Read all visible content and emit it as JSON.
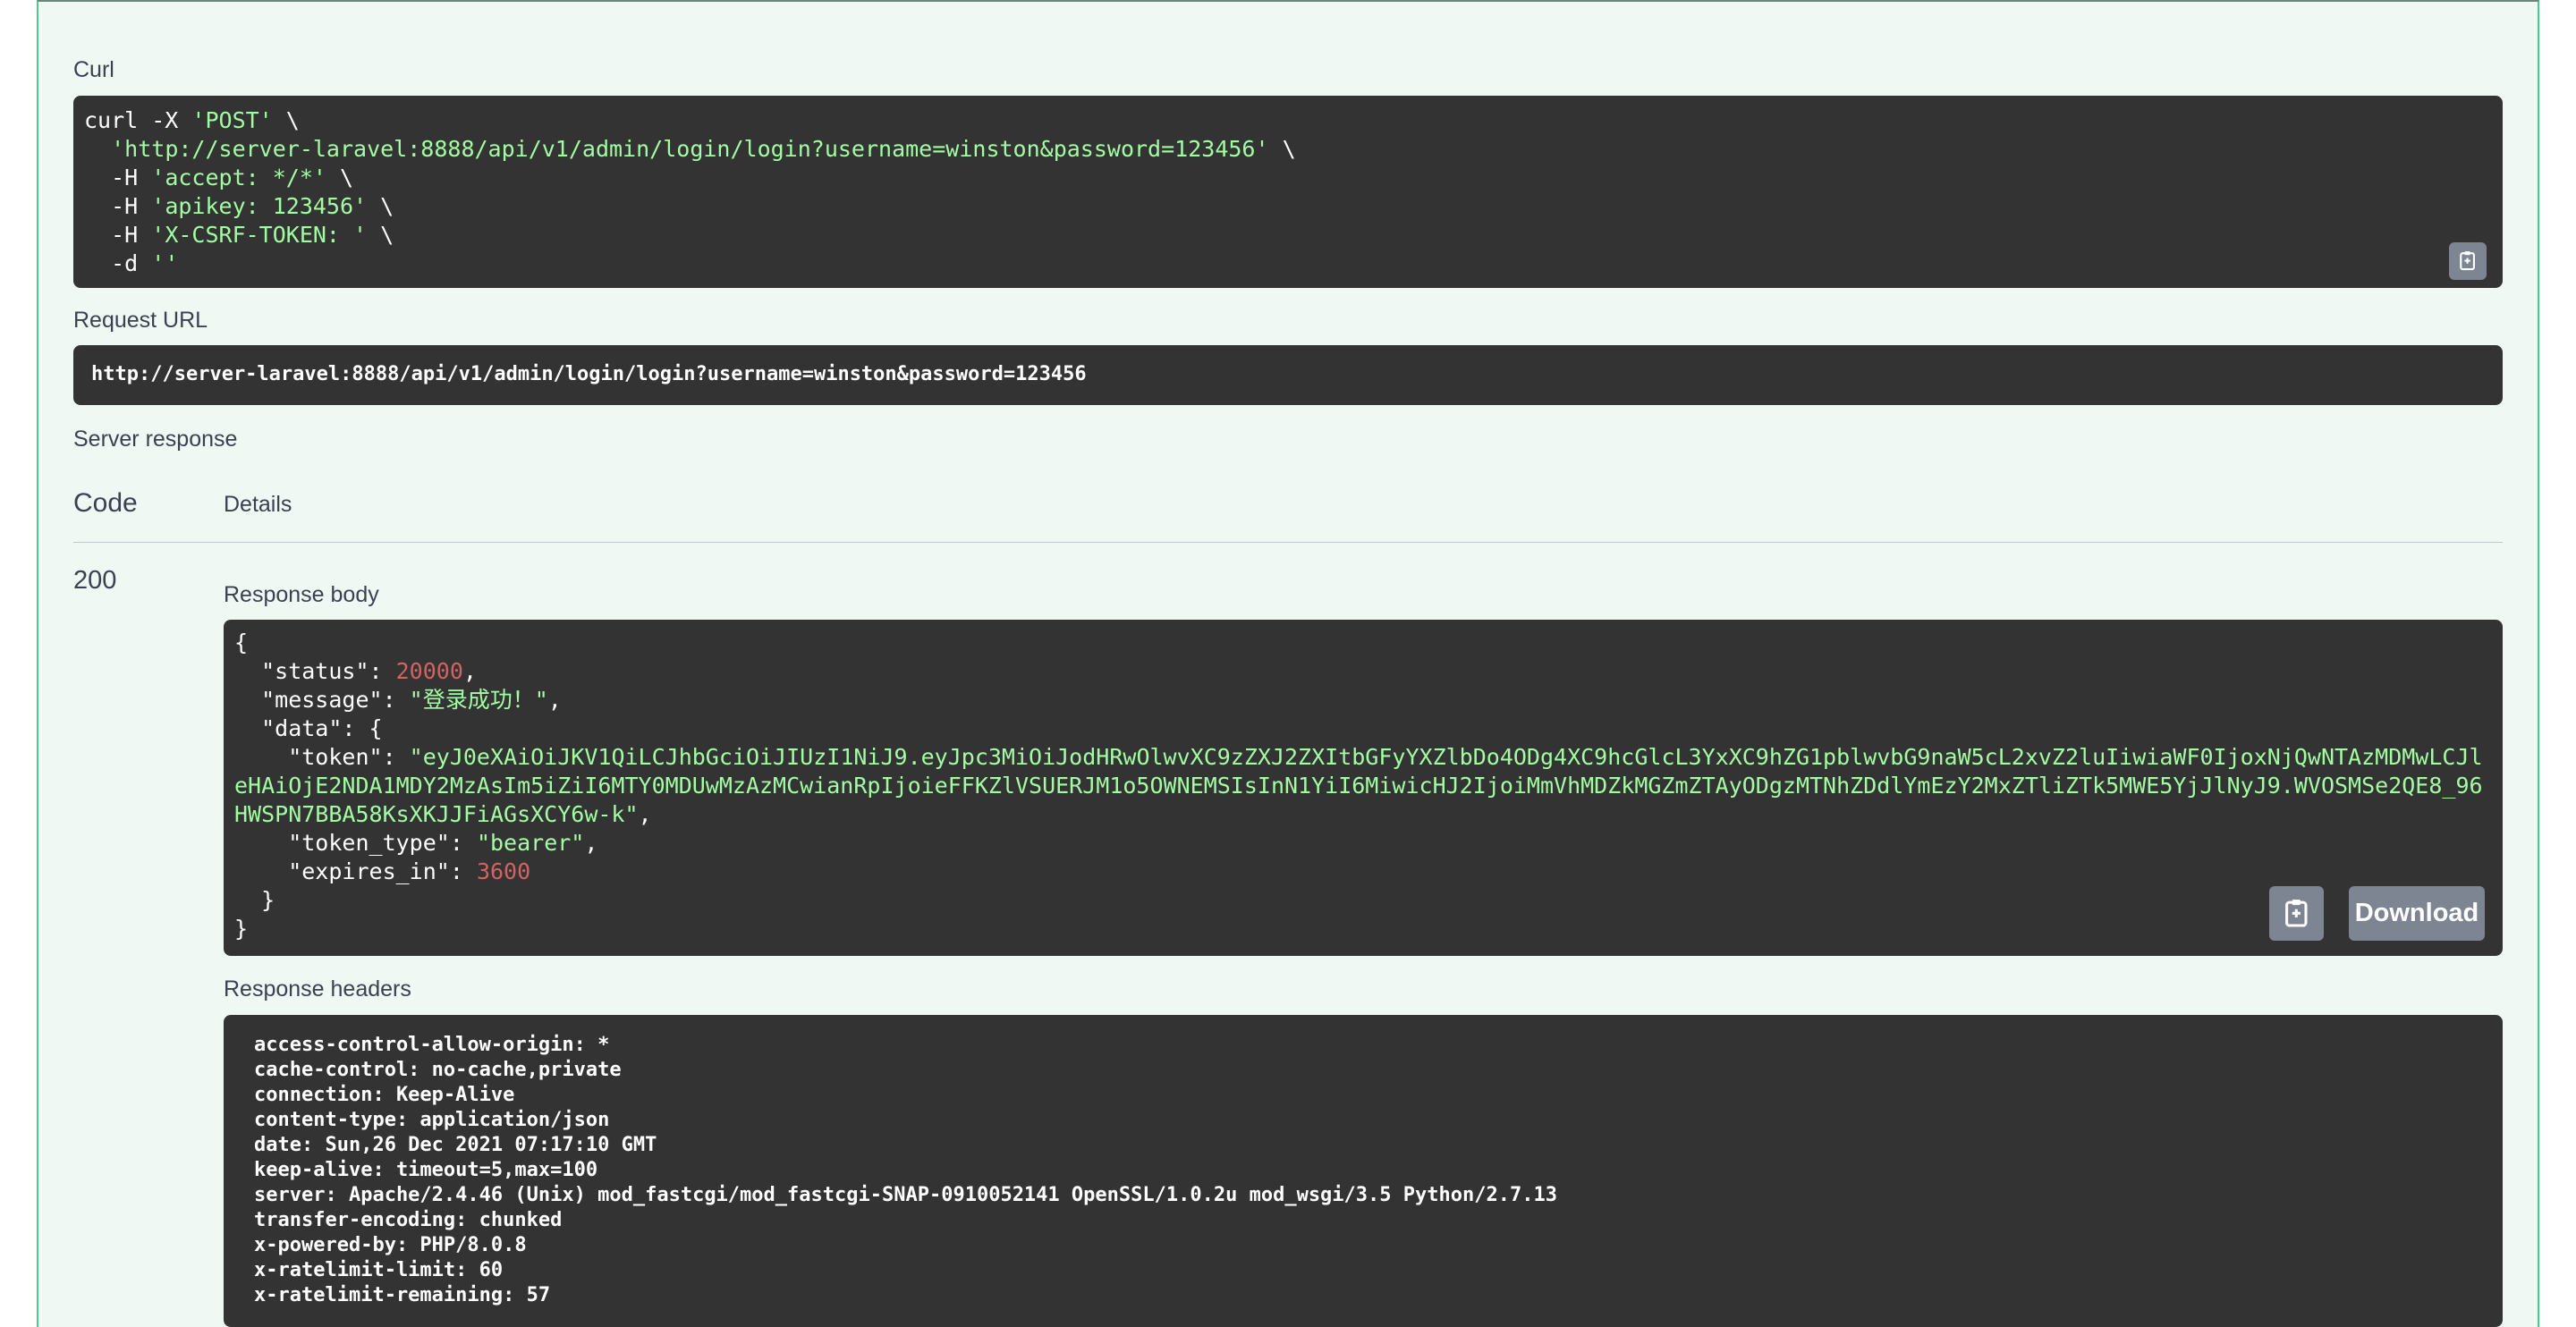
{
  "sections": {
    "curl_label": "Curl",
    "request_url_label": "Request URL",
    "server_response_label": "Server response",
    "code_col": "Code",
    "details_col": "Details",
    "response_body_label": "Response body",
    "response_headers_label": "Response headers"
  },
  "curl": [
    [
      "curl -X ",
      {
        "s": "'POST'"
      },
      " \\"
    ],
    [
      "  ",
      {
        "s": "'http://server-laravel:8888/api/v1/admin/login/login?username=winston&password=123456'"
      },
      " \\"
    ],
    [
      "  -H ",
      {
        "s": "'accept: */*'"
      },
      " \\"
    ],
    [
      "  -H ",
      {
        "s": "'apikey: 123456'"
      },
      " \\"
    ],
    [
      "  -H ",
      {
        "s": "'X-CSRF-TOKEN: '"
      },
      " \\"
    ],
    [
      "  -d ",
      {
        "s": "''"
      }
    ]
  ],
  "request_url": "http://server-laravel:8888/api/v1/admin/login/login?username=winston&password=123456",
  "response": {
    "code": "200",
    "body": {
      "open": "{",
      "status_key": "  \"status\": ",
      "status_val": "20000",
      "message_key": "  \"message\": ",
      "message_val": "\"登录成功！\"",
      "data_key": "  \"data\": {",
      "token_key": "    \"token\": ",
      "token_val": "\"eyJ0eXAiOiJKV1QiLCJhbGciOiJIUzI1NiJ9.eyJpc3MiOiJodHRwOlwvXC9zZXJ2ZXItbGFyYXZlbDo4ODg4XC9hcGlcL3YxXC9hZG1pblwvbG9naW5cL2xvZ2luIiwiaWF0IjoxNjQwNTAzMDMwLCJleHAiOjE2NDA1MDY2MzAsIm5iZiI6MTY0MDUwMzAzMCwianRpIjoieFFKZlVSUERJM1o5OWNEMSIsInN1YiI6MiwicHJ2IjoiMmVhMDZkMGZmZTAyODgzMTNhZDdlYmEzY2MxZTliZTk5MWE5YjJlNyJ9.WVOSMSe2QE8_96HWSPN7BBA58KsXKJJFiAGsXCY6w-k\"",
      "token_sep": ",",
      "token_type_key": "    \"token_type\": ",
      "token_type_val": "\"bearer\"",
      "expires_key": "    \"expires_in\": ",
      "expires_val": "3600",
      "data_close": "  }",
      "close": "}"
    },
    "download_label": "Download",
    "headers": [
      "access-control-allow-origin: *",
      "cache-control: no-cache,private",
      "connection: Keep-Alive",
      "content-type: application/json",
      "date: Sun,26 Dec 2021 07:17:10 GMT",
      "keep-alive: timeout=5,max=100",
      "server: Apache/2.4.46 (Unix) mod_fastcgi/mod_fastcgi-SNAP-0910052141 OpenSSL/1.0.2u mod_wsgi/3.5 Python/2.7.13",
      "transfer-encoding: chunked",
      "x-powered-by: PHP/8.0.8",
      "x-ratelimit-limit: 60",
      "x-ratelimit-remaining: 57"
    ]
  },
  "icons": {
    "copy": "clipboard-icon"
  },
  "colors": {
    "panel_bg": "#f0f8f4",
    "panel_border": "#49cc90",
    "code_bg": "#333333",
    "string": "#a2fca2",
    "number": "#d36363",
    "button_bg": "#7d8492"
  }
}
